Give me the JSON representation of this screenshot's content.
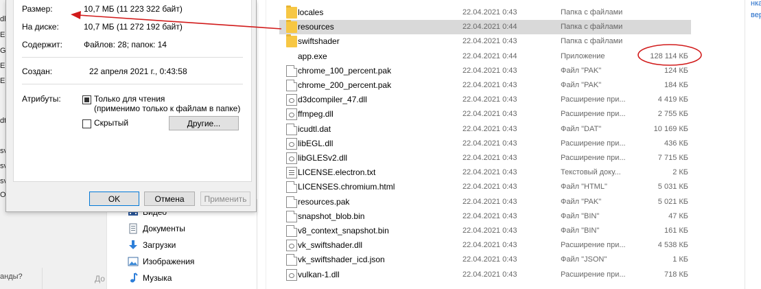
{
  "left_edge": {
    "fragments": [
      "dl",
      "EG",
      "GL",
      "EN",
      "EN",
      "dt",
      "sv",
      "sv",
      "sv",
      "OT"
    ],
    "bottom_text": "анды?",
    "bottom_text2": "До"
  },
  "nav_pane": {
    "items": [
      {
        "label": "Видео",
        "icon": "video-icon"
      },
      {
        "label": "Документы",
        "icon": "documents-icon"
      },
      {
        "label": "Загрузки",
        "icon": "downloads-icon"
      },
      {
        "label": "Изображения",
        "icon": "pictures-icon"
      },
      {
        "label": "Музыка",
        "icon": "music-icon"
      }
    ]
  },
  "dialog": {
    "size_label": "Размер:",
    "size_value": "10,7 МБ (11 223 322 байт)",
    "disk_label": "На диске:",
    "disk_value": "10,7 МБ (11 272 192 байт)",
    "contains_label": "Содержит:",
    "contains_value": "Файлов: 28; папок: 14",
    "created_label": "Создан:",
    "created_value": "22 апреля 2021 г., 0:43:58",
    "attributes_label": "Атрибуты:",
    "readonly_label": "Только для чтения",
    "readonly_note": "(применимо только к файлам в папке)",
    "hidden_label": "Скрытый",
    "other_button": "Другие...",
    "ok_button": "OK",
    "cancel_button": "Отмена",
    "apply_button": "Применить"
  },
  "files": [
    {
      "name": "locales",
      "date": "22.04.2021 0:43",
      "type": "Папка с файлами",
      "size": "",
      "icon": "folder-icon"
    },
    {
      "name": "resources",
      "date": "22.04.2021 0:44",
      "type": "Папка с файлами",
      "size": "",
      "icon": "folder-icon",
      "selected": true
    },
    {
      "name": "swiftshader",
      "date": "22.04.2021 0:43",
      "type": "Папка с файлами",
      "size": "",
      "icon": "folder-icon"
    },
    {
      "name": "app.exe",
      "date": "22.04.2021 0:44",
      "type": "Приложение",
      "size": "128 114 КБ",
      "icon": "exe-icon"
    },
    {
      "name": "chrome_100_percent.pak",
      "date": "22.04.2021 0:43",
      "type": "Файл \"PAK\"",
      "size": "124 КБ",
      "icon": "file-icon"
    },
    {
      "name": "chrome_200_percent.pak",
      "date": "22.04.2021 0:43",
      "type": "Файл \"PAK\"",
      "size": "184 КБ",
      "icon": "file-icon"
    },
    {
      "name": "d3dcompiler_47.dll",
      "date": "22.04.2021 0:43",
      "type": "Расширение при...",
      "size": "4 419 КБ",
      "icon": "dll-icon"
    },
    {
      "name": "ffmpeg.dll",
      "date": "22.04.2021 0:43",
      "type": "Расширение при...",
      "size": "2 755 КБ",
      "icon": "dll-icon"
    },
    {
      "name": "icudtl.dat",
      "date": "22.04.2021 0:43",
      "type": "Файл \"DAT\"",
      "size": "10 169 КБ",
      "icon": "file-icon"
    },
    {
      "name": "libEGL.dll",
      "date": "22.04.2021 0:43",
      "type": "Расширение при...",
      "size": "436 КБ",
      "icon": "dll-icon"
    },
    {
      "name": "libGLESv2.dll",
      "date": "22.04.2021 0:43",
      "type": "Расширение при...",
      "size": "7 715 КБ",
      "icon": "dll-icon"
    },
    {
      "name": "LICENSE.electron.txt",
      "date": "22.04.2021 0:43",
      "type": "Текстовый доку...",
      "size": "2 КБ",
      "icon": "text-file-icon"
    },
    {
      "name": "LICENSES.chromium.html",
      "date": "22.04.2021 0:43",
      "type": "Файл \"HTML\"",
      "size": "5 031 КБ",
      "icon": "file-icon"
    },
    {
      "name": "resources.pak",
      "date": "22.04.2021 0:43",
      "type": "Файл \"PAK\"",
      "size": "5 021 КБ",
      "icon": "file-icon"
    },
    {
      "name": "snapshot_blob.bin",
      "date": "22.04.2021 0:43",
      "type": "Файл \"BIN\"",
      "size": "47 КБ",
      "icon": "file-icon"
    },
    {
      "name": "v8_context_snapshot.bin",
      "date": "22.04.2021 0:43",
      "type": "Файл \"BIN\"",
      "size": "161 КБ",
      "icon": "file-icon"
    },
    {
      "name": "vk_swiftshader.dll",
      "date": "22.04.2021 0:43",
      "type": "Расширение при...",
      "size": "4 538 КБ",
      "icon": "dll-icon"
    },
    {
      "name": "vk_swiftshader_icd.json",
      "date": "22.04.2021 0:43",
      "type": "Файл \"JSON\"",
      "size": "1 КБ",
      "icon": "file-icon"
    },
    {
      "name": "vulkan-1.dll",
      "date": "22.04.2021 0:43",
      "type": "Расширение при...",
      "size": "718 КБ",
      "icon": "dll-icon"
    }
  ],
  "right_edge": {
    "line1": "нка",
    "line2": "верн"
  },
  "colors": {
    "annotation": "#d11a1a",
    "selection": "#d9d9d9",
    "link": "#1a66c7"
  }
}
